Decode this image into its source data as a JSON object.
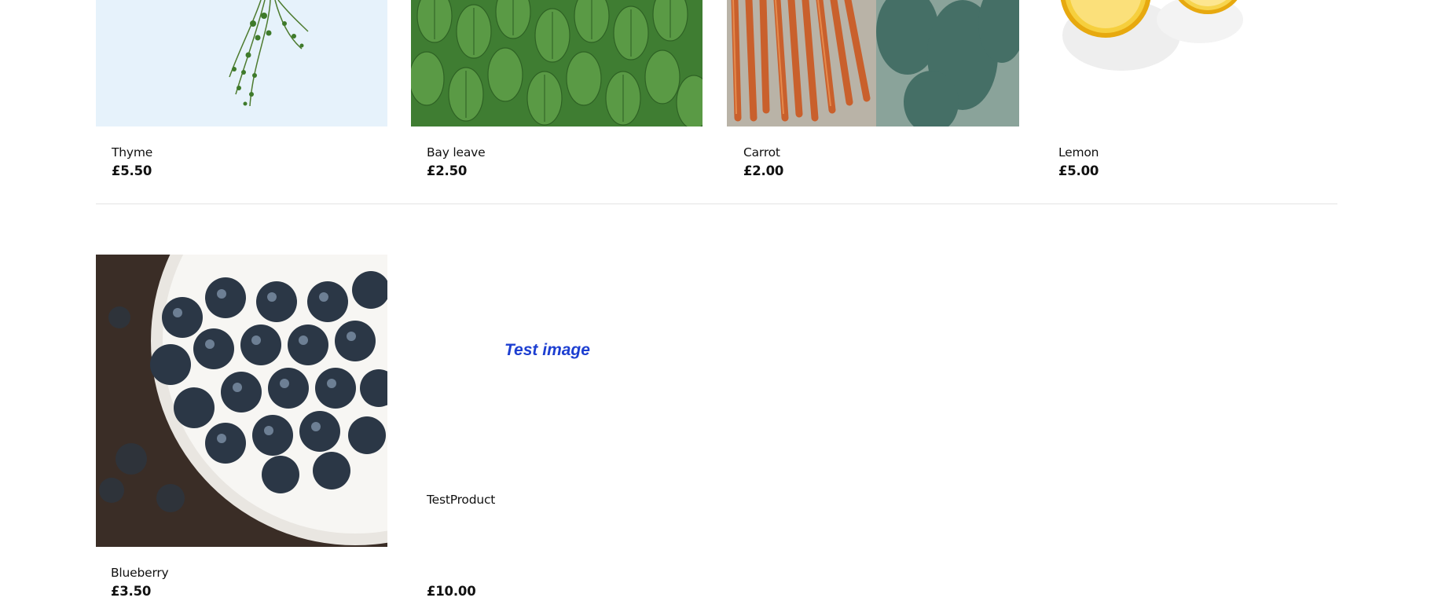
{
  "products_row_1": [
    {
      "name": "Thyme",
      "price": "£5.50",
      "image_icon": "thyme-image"
    },
    {
      "name": "Bay leave",
      "price": "£2.50",
      "image_icon": "bay-leaf-image"
    },
    {
      "name": "Carrot",
      "price": "£2.00",
      "image_icon": "carrot-image"
    },
    {
      "name": "Lemon",
      "price": "£5.00",
      "image_icon": "lemon-image"
    }
  ],
  "products_row_2": [
    {
      "name": "Blueberry",
      "price": "£3.50",
      "image_icon": "blueberry-image"
    },
    {
      "name": "TestProduct",
      "price": "£10.00",
      "image_alt": "Test image"
    }
  ],
  "colors": {
    "broken_image_alt_text": "#1d3fd1",
    "divider": "#e3e3e3"
  }
}
